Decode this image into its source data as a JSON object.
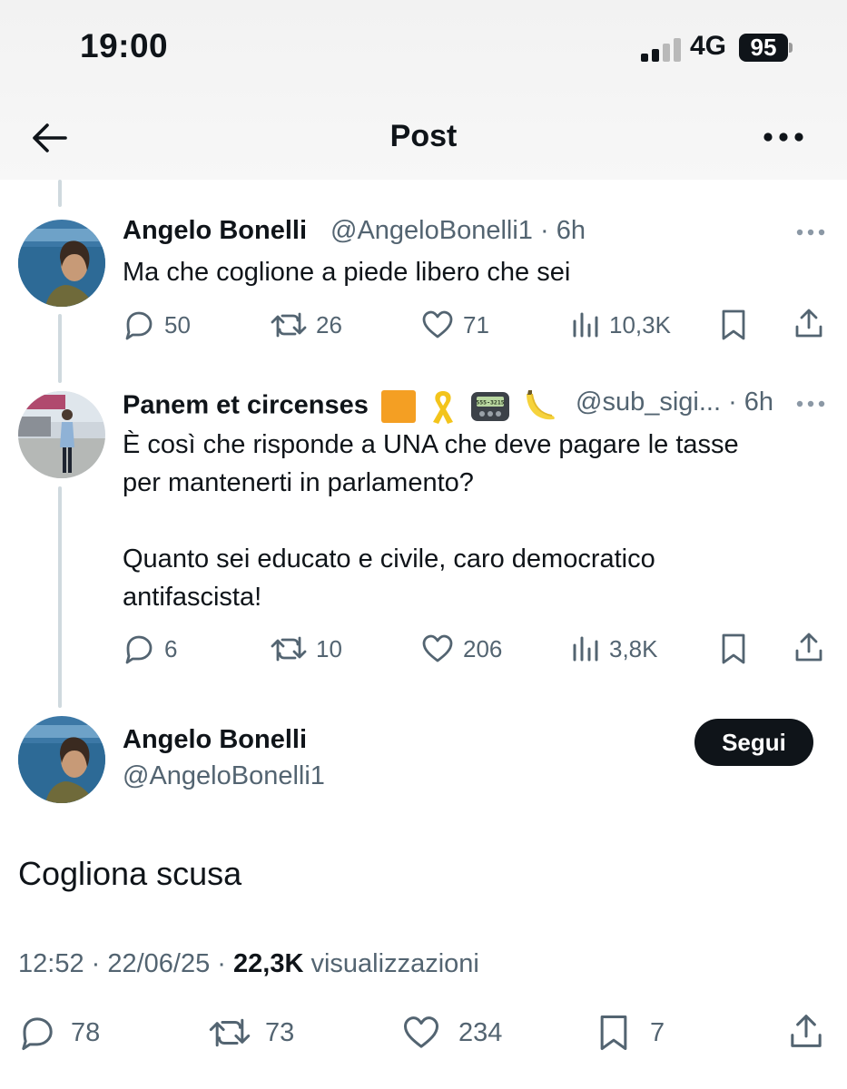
{
  "status_bar": {
    "time": "19:00",
    "network": "4G",
    "battery": "95"
  },
  "header": {
    "title": "Post"
  },
  "replies": [
    {
      "name": "Angelo Bonelli",
      "handle": "@AngeloBonelli1",
      "age": "6h",
      "text_lines": [
        "Ma che coglione a piede libero che sei"
      ],
      "replies": "50",
      "reposts": "26",
      "likes": "71",
      "views": "10,3K"
    },
    {
      "name": "Panem et circenses",
      "handle": "@sub_sigi...",
      "age": "6h",
      "text_lines": [
        "È così che risponde a UNA che deve pagare le tasse",
        "per mantenerti in parlamento?",
        "",
        "Quanto sei educato e civile, caro democratico",
        "antifascista!"
      ],
      "replies": "6",
      "reposts": "10",
      "likes": "206",
      "views": "3,8K"
    }
  ],
  "main_post": {
    "name": "Angelo Bonelli",
    "handle": "@AngeloBonelli1",
    "follow_label": "Segui",
    "text": "Cogliona scusa",
    "time": "12:52",
    "date": "22/06/25",
    "views": "22,3K",
    "views_label": "visualizzazioni",
    "replies": "78",
    "reposts": "73",
    "likes": "234",
    "bookmarks": "7"
  },
  "pager_display": "555-3215",
  "colors": {
    "text": "#0f1419",
    "secondary": "#536471",
    "thread": "#cfd9de",
    "follow_bg": "#0f1419"
  },
  "icons": [
    "back-arrow-icon",
    "more-icon",
    "reply-icon",
    "repost-icon",
    "like-icon",
    "views-icon",
    "bookmark-icon",
    "share-icon",
    "orange-square-emoji",
    "ribbon-emoji",
    "pager-emoji",
    "banana-emoji"
  ]
}
